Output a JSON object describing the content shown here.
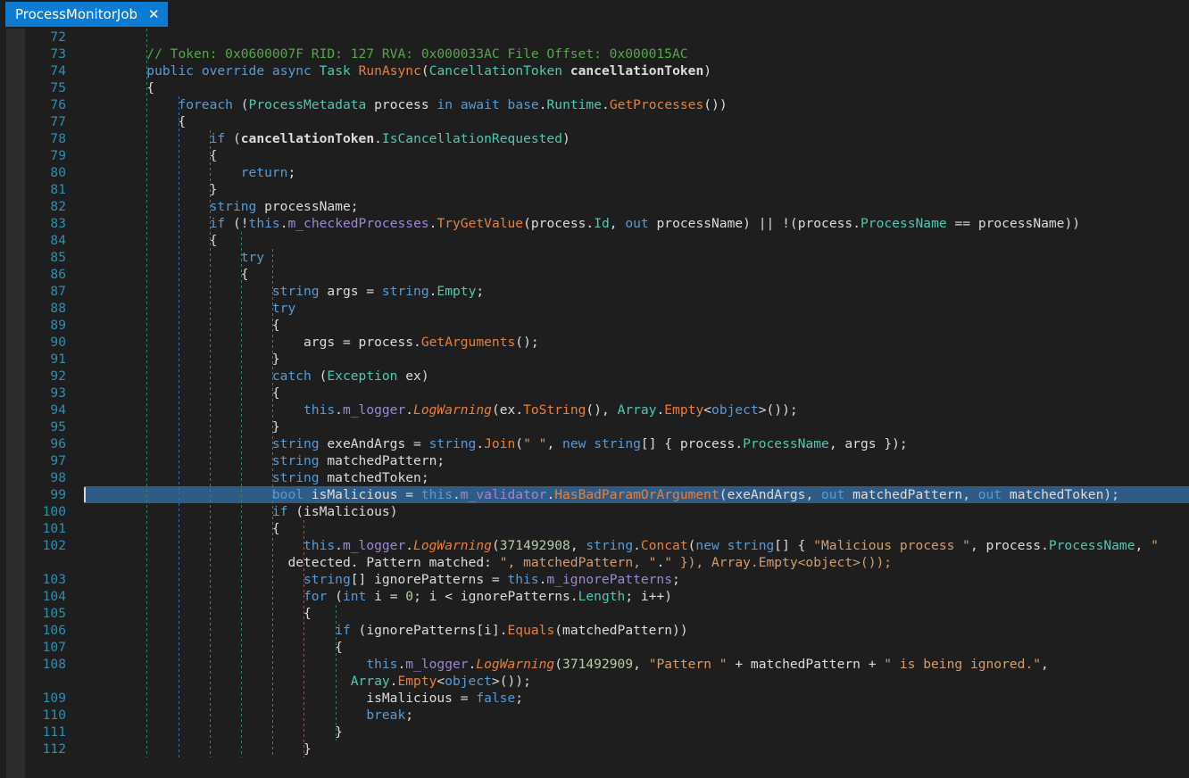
{
  "window": {
    "title": "ProcessMonitorJob",
    "accent_color": "#0c7bd4",
    "background_color": "#1e1e1e",
    "selection_color": "#2e5c86"
  },
  "tab": {
    "label": "ProcessMonitorJob",
    "close_glyph": "✕",
    "close_icon_name": "close-icon"
  },
  "editor": {
    "language": "csharp",
    "first_visible_line": 72,
    "last_visible_line": 112,
    "selected_line": 99,
    "caret_line": 99,
    "caret_column": 1,
    "gutter_color": "#2d2d30",
    "line_number_color": "#2b91af",
    "indent_guide_colors": [
      "#3c7a63",
      "#3b6ea5",
      "#8e4fa8",
      "#3c7a63",
      "#a0544a",
      "#a0544a",
      "#3c7a63"
    ]
  },
  "lines": [
    {
      "n": 72,
      "text": ""
    },
    {
      "n": 73,
      "text": "        // Token: 0x0600007F RID: 127 RVA: 0x000033AC File Offset: 0x000015AC"
    },
    {
      "n": 74,
      "text": "        public override async Task RunAsync(CancellationToken cancellationToken)"
    },
    {
      "n": 75,
      "text": "        {"
    },
    {
      "n": 76,
      "text": "            foreach (ProcessMetadata process in await base.Runtime.GetProcesses())"
    },
    {
      "n": 77,
      "text": "            {"
    },
    {
      "n": 78,
      "text": "                if (cancellationToken.IsCancellationRequested)"
    },
    {
      "n": 79,
      "text": "                {"
    },
    {
      "n": 80,
      "text": "                    return;"
    },
    {
      "n": 81,
      "text": "                }"
    },
    {
      "n": 82,
      "text": "                string processName;"
    },
    {
      "n": 83,
      "text": "                if (!this.m_checkedProcesses.TryGetValue(process.Id, out processName) || !(process.ProcessName == processName))"
    },
    {
      "n": 84,
      "text": "                {"
    },
    {
      "n": 85,
      "text": "                    try"
    },
    {
      "n": 86,
      "text": "                    {"
    },
    {
      "n": 87,
      "text": "                        string args = string.Empty;"
    },
    {
      "n": 88,
      "text": "                        try"
    },
    {
      "n": 89,
      "text": "                        {"
    },
    {
      "n": 90,
      "text": "                            args = process.GetArguments();"
    },
    {
      "n": 91,
      "text": "                        }"
    },
    {
      "n": 92,
      "text": "                        catch (Exception ex)"
    },
    {
      "n": 93,
      "text": "                        {"
    },
    {
      "n": 94,
      "text": "                            this.m_logger.LogWarning(ex.ToString(), Array.Empty<object>());"
    },
    {
      "n": 95,
      "text": "                        }"
    },
    {
      "n": 96,
      "text": "                        string exeAndArgs = string.Join(\" \", new string[] { process.ProcessName, args });"
    },
    {
      "n": 97,
      "text": "                        string matchedPattern;"
    },
    {
      "n": 98,
      "text": "                        string matchedToken;"
    },
    {
      "n": 99,
      "text": "                        bool isMalicious = this.m_validator.HasBadParamOrArgument(exeAndArgs, out matchedPattern, out matchedToken);"
    },
    {
      "n": 100,
      "text": "                        if (isMalicious)"
    },
    {
      "n": 101,
      "text": "                        {"
    },
    {
      "n": 102,
      "text": "                            this.m_logger.LogWarning(371492908, string.Concat(new string[] { \"Malicious process \", process.ProcessName, \" detected. Pattern matched: \", matchedPattern, \".\" }), Array.Empty<object>());"
    },
    {
      "n": 103,
      "text": "                            string[] ignorePatterns = this.m_ignorePatterns;"
    },
    {
      "n": 104,
      "text": "                            for (int i = 0; i < ignorePatterns.Length; i++)"
    },
    {
      "n": 105,
      "text": "                            {"
    },
    {
      "n": 106,
      "text": "                                if (ignorePatterns[i].Equals(matchedPattern))"
    },
    {
      "n": 107,
      "text": "                                {"
    },
    {
      "n": 108,
      "text": "                                    this.m_logger.LogWarning(371492909, \"Pattern \" + matchedPattern + \" is being ignored.\", Array.Empty<object>());"
    },
    {
      "n": 109,
      "text": "                                    isMalicious = false;"
    },
    {
      "n": 110,
      "text": "                                    break;"
    },
    {
      "n": 111,
      "text": "                                }"
    },
    {
      "n": 112,
      "text": "                            }"
    }
  ]
}
